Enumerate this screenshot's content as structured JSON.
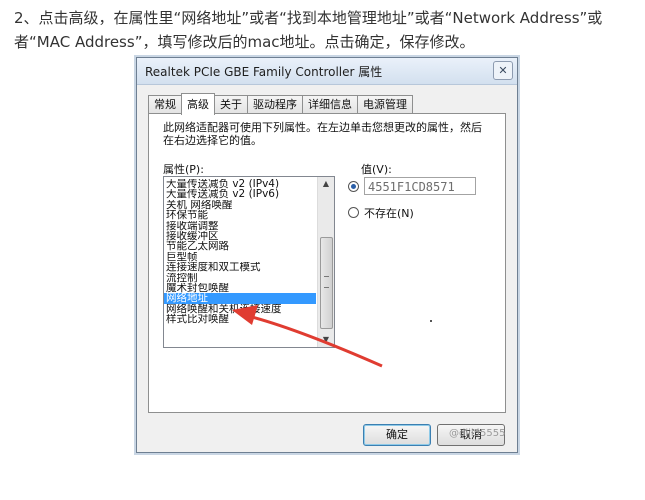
{
  "article": {
    "text": "2、点击高级，在属性里“网络地址”或者“找到本地管理地址”或者“Network Address”或者“MAC Address”，填写修改后的mac地址。点击确定，保存修改。"
  },
  "dialog": {
    "title": "Realtek PCIe GBE Family Controller 属性",
    "close_symbol": "✕",
    "tabs": [
      "常规",
      "高级",
      "关于",
      "驱动程序",
      "详细信息",
      "电源管理"
    ],
    "active_tab": "高级",
    "description": "此网络适配器可使用下列属性。在左边单击您想更改的属性，然后在右边选择它的值。",
    "property_label": "属性(P):",
    "properties": [
      "大量传送减负 v2 (IPv4)",
      "大量传送减负 v2 (IPv6)",
      "关机 网络唤醒",
      "环保节能",
      "接收端调整",
      "接收缓冲区",
      "节能乙太网路",
      "巨型帧",
      "连接速度和双工模式",
      "流控制",
      "魔术封包唤醒",
      "网络地址",
      "网络唤醒和关机连接速度",
      "样式比对唤醒"
    ],
    "selected_property": "网络地址",
    "value_label": "值(V):",
    "value": "4551F1CD8571",
    "value_option_selected": true,
    "not_present_label": "不存在(N)",
    "ok_label": "确定",
    "cancel_label": "取消"
  },
  "watermark": "@dljl55555",
  "colors": {
    "selection": "#3399ff",
    "arrow": "#e03c31"
  }
}
